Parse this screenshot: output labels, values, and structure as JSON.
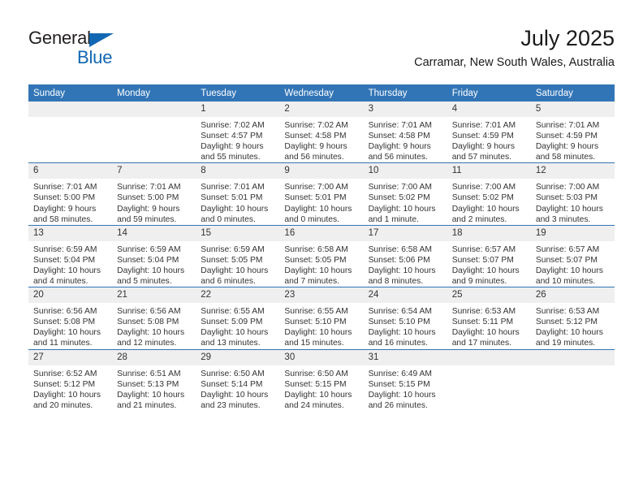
{
  "brand": {
    "name_part1": "General",
    "name_part2": "Blue",
    "accent_color": "#1267b2"
  },
  "header": {
    "title": "July 2025",
    "subtitle": "Carramar, New South Wales, Australia"
  },
  "theme": {
    "header_blue": "#3275b6",
    "daynum_bg": "#efefef",
    "text": "#333333"
  },
  "weekdays": [
    "Sunday",
    "Monday",
    "Tuesday",
    "Wednesday",
    "Thursday",
    "Friday",
    "Saturday"
  ],
  "weeks": [
    [
      {
        "day": "",
        "empty": true,
        "sunrise": "",
        "sunset": "",
        "daylight1": "",
        "daylight2": ""
      },
      {
        "day": "",
        "empty": true,
        "sunrise": "",
        "sunset": "",
        "daylight1": "",
        "daylight2": ""
      },
      {
        "day": "1",
        "sunrise": "Sunrise: 7:02 AM",
        "sunset": "Sunset: 4:57 PM",
        "daylight1": "Daylight: 9 hours",
        "daylight2": "and 55 minutes."
      },
      {
        "day": "2",
        "sunrise": "Sunrise: 7:02 AM",
        "sunset": "Sunset: 4:58 PM",
        "daylight1": "Daylight: 9 hours",
        "daylight2": "and 56 minutes."
      },
      {
        "day": "3",
        "sunrise": "Sunrise: 7:01 AM",
        "sunset": "Sunset: 4:58 PM",
        "daylight1": "Daylight: 9 hours",
        "daylight2": "and 56 minutes."
      },
      {
        "day": "4",
        "sunrise": "Sunrise: 7:01 AM",
        "sunset": "Sunset: 4:59 PM",
        "daylight1": "Daylight: 9 hours",
        "daylight2": "and 57 minutes."
      },
      {
        "day": "5",
        "sunrise": "Sunrise: 7:01 AM",
        "sunset": "Sunset: 4:59 PM",
        "daylight1": "Daylight: 9 hours",
        "daylight2": "and 58 minutes."
      }
    ],
    [
      {
        "day": "6",
        "sunrise": "Sunrise: 7:01 AM",
        "sunset": "Sunset: 5:00 PM",
        "daylight1": "Daylight: 9 hours",
        "daylight2": "and 58 minutes."
      },
      {
        "day": "7",
        "sunrise": "Sunrise: 7:01 AM",
        "sunset": "Sunset: 5:00 PM",
        "daylight1": "Daylight: 9 hours",
        "daylight2": "and 59 minutes."
      },
      {
        "day": "8",
        "sunrise": "Sunrise: 7:01 AM",
        "sunset": "Sunset: 5:01 PM",
        "daylight1": "Daylight: 10 hours",
        "daylight2": "and 0 minutes."
      },
      {
        "day": "9",
        "sunrise": "Sunrise: 7:00 AM",
        "sunset": "Sunset: 5:01 PM",
        "daylight1": "Daylight: 10 hours",
        "daylight2": "and 0 minutes."
      },
      {
        "day": "10",
        "sunrise": "Sunrise: 7:00 AM",
        "sunset": "Sunset: 5:02 PM",
        "daylight1": "Daylight: 10 hours",
        "daylight2": "and 1 minute."
      },
      {
        "day": "11",
        "sunrise": "Sunrise: 7:00 AM",
        "sunset": "Sunset: 5:02 PM",
        "daylight1": "Daylight: 10 hours",
        "daylight2": "and 2 minutes."
      },
      {
        "day": "12",
        "sunrise": "Sunrise: 7:00 AM",
        "sunset": "Sunset: 5:03 PM",
        "daylight1": "Daylight: 10 hours",
        "daylight2": "and 3 minutes."
      }
    ],
    [
      {
        "day": "13",
        "sunrise": "Sunrise: 6:59 AM",
        "sunset": "Sunset: 5:04 PM",
        "daylight1": "Daylight: 10 hours",
        "daylight2": "and 4 minutes."
      },
      {
        "day": "14",
        "sunrise": "Sunrise: 6:59 AM",
        "sunset": "Sunset: 5:04 PM",
        "daylight1": "Daylight: 10 hours",
        "daylight2": "and 5 minutes."
      },
      {
        "day": "15",
        "sunrise": "Sunrise: 6:59 AM",
        "sunset": "Sunset: 5:05 PM",
        "daylight1": "Daylight: 10 hours",
        "daylight2": "and 6 minutes."
      },
      {
        "day": "16",
        "sunrise": "Sunrise: 6:58 AM",
        "sunset": "Sunset: 5:05 PM",
        "daylight1": "Daylight: 10 hours",
        "daylight2": "and 7 minutes."
      },
      {
        "day": "17",
        "sunrise": "Sunrise: 6:58 AM",
        "sunset": "Sunset: 5:06 PM",
        "daylight1": "Daylight: 10 hours",
        "daylight2": "and 8 minutes."
      },
      {
        "day": "18",
        "sunrise": "Sunrise: 6:57 AM",
        "sunset": "Sunset: 5:07 PM",
        "daylight1": "Daylight: 10 hours",
        "daylight2": "and 9 minutes."
      },
      {
        "day": "19",
        "sunrise": "Sunrise: 6:57 AM",
        "sunset": "Sunset: 5:07 PM",
        "daylight1": "Daylight: 10 hours",
        "daylight2": "and 10 minutes."
      }
    ],
    [
      {
        "day": "20",
        "sunrise": "Sunrise: 6:56 AM",
        "sunset": "Sunset: 5:08 PM",
        "daylight1": "Daylight: 10 hours",
        "daylight2": "and 11 minutes."
      },
      {
        "day": "21",
        "sunrise": "Sunrise: 6:56 AM",
        "sunset": "Sunset: 5:08 PM",
        "daylight1": "Daylight: 10 hours",
        "daylight2": "and 12 minutes."
      },
      {
        "day": "22",
        "sunrise": "Sunrise: 6:55 AM",
        "sunset": "Sunset: 5:09 PM",
        "daylight1": "Daylight: 10 hours",
        "daylight2": "and 13 minutes."
      },
      {
        "day": "23",
        "sunrise": "Sunrise: 6:55 AM",
        "sunset": "Sunset: 5:10 PM",
        "daylight1": "Daylight: 10 hours",
        "daylight2": "and 15 minutes."
      },
      {
        "day": "24",
        "sunrise": "Sunrise: 6:54 AM",
        "sunset": "Sunset: 5:10 PM",
        "daylight1": "Daylight: 10 hours",
        "daylight2": "and 16 minutes."
      },
      {
        "day": "25",
        "sunrise": "Sunrise: 6:53 AM",
        "sunset": "Sunset: 5:11 PM",
        "daylight1": "Daylight: 10 hours",
        "daylight2": "and 17 minutes."
      },
      {
        "day": "26",
        "sunrise": "Sunrise: 6:53 AM",
        "sunset": "Sunset: 5:12 PM",
        "daylight1": "Daylight: 10 hours",
        "daylight2": "and 19 minutes."
      }
    ],
    [
      {
        "day": "27",
        "sunrise": "Sunrise: 6:52 AM",
        "sunset": "Sunset: 5:12 PM",
        "daylight1": "Daylight: 10 hours",
        "daylight2": "and 20 minutes."
      },
      {
        "day": "28",
        "sunrise": "Sunrise: 6:51 AM",
        "sunset": "Sunset: 5:13 PM",
        "daylight1": "Daylight: 10 hours",
        "daylight2": "and 21 minutes."
      },
      {
        "day": "29",
        "sunrise": "Sunrise: 6:50 AM",
        "sunset": "Sunset: 5:14 PM",
        "daylight1": "Daylight: 10 hours",
        "daylight2": "and 23 minutes."
      },
      {
        "day": "30",
        "sunrise": "Sunrise: 6:50 AM",
        "sunset": "Sunset: 5:15 PM",
        "daylight1": "Daylight: 10 hours",
        "daylight2": "and 24 minutes."
      },
      {
        "day": "31",
        "sunrise": "Sunrise: 6:49 AM",
        "sunset": "Sunset: 5:15 PM",
        "daylight1": "Daylight: 10 hours",
        "daylight2": "and 26 minutes."
      },
      {
        "day": "",
        "empty": true,
        "sunrise": "",
        "sunset": "",
        "daylight1": "",
        "daylight2": ""
      },
      {
        "day": "",
        "empty": true,
        "sunrise": "",
        "sunset": "",
        "daylight1": "",
        "daylight2": ""
      }
    ]
  ]
}
